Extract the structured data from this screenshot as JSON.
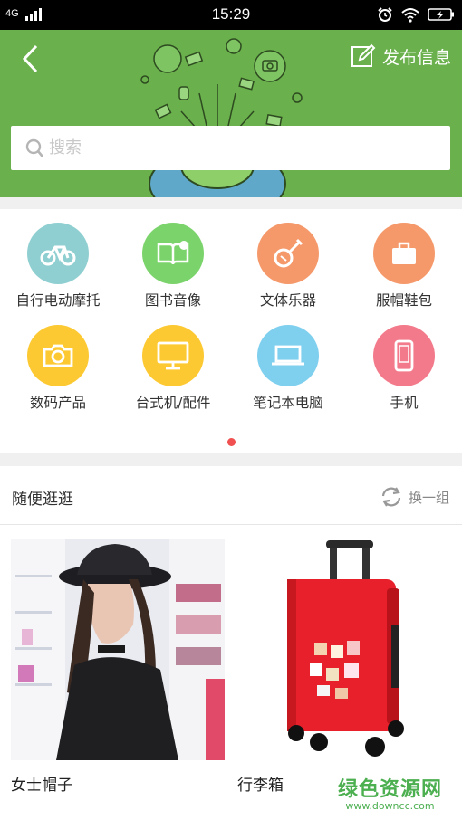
{
  "status_bar": {
    "network": "4G",
    "time": "15:29"
  },
  "header": {
    "publish_label": "发布信息"
  },
  "search": {
    "placeholder": "搜索"
  },
  "categories": [
    {
      "label": "自行电动摩托",
      "color": "#8fcfd1",
      "icon": "bicycle-icon"
    },
    {
      "label": "图书音像",
      "color": "#7bd36b",
      "icon": "book-icon"
    },
    {
      "label": "文体乐器",
      "color": "#f5996b",
      "icon": "instrument-icon"
    },
    {
      "label": "服帽鞋包",
      "color": "#f5996b",
      "icon": "briefcase-icon"
    },
    {
      "label": "数码产品",
      "color": "#fcc932",
      "icon": "camera-icon"
    },
    {
      "label": "台式机/配件",
      "color": "#fcc932",
      "icon": "monitor-icon"
    },
    {
      "label": "笔记本电脑",
      "color": "#7fcfee",
      "icon": "laptop-icon"
    },
    {
      "label": "手机",
      "color": "#f37a8a",
      "icon": "phone-icon"
    }
  ],
  "section": {
    "title": "随便逛逛",
    "refresh_label": "换一组"
  },
  "products": [
    {
      "name": "女士帽子"
    },
    {
      "name": "行李箱"
    }
  ],
  "watermark": {
    "line1": "绿色资源网",
    "line2": "www.downcc.com"
  },
  "colors": {
    "brand_green": "#6ab04c",
    "page_dot": "#f05050"
  }
}
